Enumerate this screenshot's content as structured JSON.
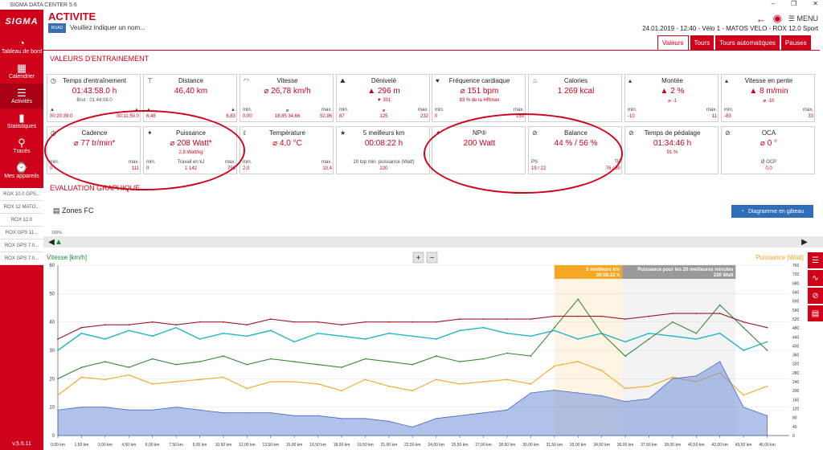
{
  "window": {
    "title": "SIGMA DATA CENTER 5.6",
    "minimize": "–",
    "maximize": "❐",
    "close": "✕"
  },
  "sidebar": {
    "logo": "SIGMA",
    "items": [
      {
        "label": "Tableau de bord",
        "icon": "dashboard-icon",
        "glyph": "◔"
      },
      {
        "label": "Calendrier",
        "icon": "calendar-icon",
        "glyph": "▦"
      },
      {
        "label": "Activités",
        "icon": "activities-icon",
        "glyph": "☰"
      },
      {
        "label": "Statistiques",
        "icon": "stats-icon",
        "glyph": "▮"
      },
      {
        "label": "Tracés",
        "icon": "map-pin-icon",
        "glyph": "⚲"
      },
      {
        "label": "Mes appareils",
        "icon": "devices-icon",
        "glyph": "⌚"
      }
    ],
    "devices": [
      "ROX 10.0 GPS...",
      "ROX 12 MATO...",
      "ROX 12.0",
      "ROX GPS 11...",
      "ROX GPS 7.0...",
      "ROX GPS 7.0..."
    ],
    "version": "v.5.6.11"
  },
  "header": {
    "title": "ACTIVITE",
    "badge": "ROAD",
    "name_placeholder": "Veuillez indiquer un nom...",
    "info": "24.01.2019  -  12:40  -  Vélo 1  -  MATOS VELO  -  ROX 12.0 Sport",
    "menu": "MENU"
  },
  "tabs": [
    "Valeurs",
    "Tours",
    "Tours automatiques",
    "Pauses"
  ],
  "sections": {
    "training": "VALEURS D'ENTRAINEMENT",
    "graph": "EVALUATION GRAPHIQUE"
  },
  "cards": [
    {
      "icon": "clock-icon",
      "glyph": "◷",
      "label": "Temps d'entraînement",
      "main": "01:43:58.0 h",
      "sub": "Brut : 01:44:08.0",
      "row_l": [
        "▲",
        "▲"
      ],
      "row_v": [
        "00:20:39.0",
        "00:11:50.0"
      ]
    },
    {
      "icon": "distance-icon",
      "glyph": "⊤",
      "label": "Distance",
      "main": "46,40 km",
      "row_l": [
        "▲",
        "▲"
      ],
      "row_v": [
        "6,48",
        "6,83"
      ]
    },
    {
      "icon": "speed-icon",
      "glyph": "◠",
      "label": "Vitesse",
      "main": "⌀ 26,78 km/h",
      "row_l": [
        "min.",
        "⌀",
        "max."
      ],
      "row_v": [
        "0,00",
        "18,85  34,66",
        "52,96"
      ]
    },
    {
      "icon": "elevation-icon",
      "glyph": "⛰",
      "label": "Dénivelé",
      "main": "▲ 296 m",
      "sub": "▼ 301",
      "row_l": [
        "min.",
        "⌀",
        "max."
      ],
      "row_v": [
        "87",
        "125",
        "232"
      ]
    },
    {
      "icon": "heart-icon",
      "glyph": "♥",
      "label": "Fréquence cardiaque",
      "main": "⌀ 151 bpm",
      "sub": "83 % de la HRmax",
      "row_l": [
        "min.",
        "max."
      ],
      "row_v": [
        "0",
        "169"
      ]
    },
    {
      "icon": "calories-icon",
      "glyph": "♨",
      "label": "Calories",
      "main": "1 269 kcal"
    },
    {
      "icon": "climb-icon",
      "glyph": "▴",
      "label": "Montée",
      "main": "▲ 2 %",
      "sub": "⌀ -1",
      "row_l": [
        "min.",
        "max."
      ],
      "row_v": [
        "-10",
        "11"
      ]
    },
    {
      "icon": "slope-speed-icon",
      "glyph": "▴",
      "label": "Vitesse en pente",
      "main": "▲ 8 m/min",
      "sub": "⌀ -10",
      "row_l": [
        "min.",
        "max."
      ],
      "row_v": [
        "-83",
        "33"
      ]
    },
    {
      "icon": "cadence-icon",
      "glyph": "◷",
      "label": "Cadence",
      "main": "⌀ 77 tr/min*",
      "row_l": [
        "min.",
        "max."
      ],
      "row_v": [
        "0",
        "111"
      ]
    },
    {
      "icon": "power-icon",
      "glyph": "✦",
      "label": "Puissance",
      "main": "⌀ 208 Watt*",
      "sub": "2,8 Watt/kg",
      "row_l": [
        "min.",
        "Travail en kJ",
        "max."
      ],
      "row_v": [
        "0",
        "1 142",
        "756"
      ]
    },
    {
      "icon": "temperature-icon",
      "glyph": "ℓ",
      "label": "Température",
      "main": "⌀ 4,0 °C",
      "row_l": [
        "min.",
        "max."
      ],
      "row_v": [
        "2,0",
        "10,4"
      ]
    },
    {
      "icon": "star-icon",
      "glyph": "★",
      "label": "5 meilleurs km",
      "main": "00:08:22 h",
      "row_l": [
        "20 top min. puissance (Watt)"
      ],
      "row_v": [
        "220"
      ]
    },
    {
      "icon": "np-icon",
      "glyph": "✦",
      "label": "NP®",
      "main": "200 Watt"
    },
    {
      "icon": "balance-icon",
      "glyph": "⊘",
      "label": "Balance",
      "main": "44 %  /  56 %",
      "row_l": [
        "PS",
        "TE"
      ],
      "row_v": [
        "19  /  22",
        "76  /  80"
      ]
    },
    {
      "icon": "pedal-time-icon",
      "glyph": "⊘",
      "label": "Temps de pédalage",
      "main": "01:34:46 h",
      "sub": "91 %"
    },
    {
      "icon": "oca-icon",
      "glyph": "⊘",
      "label": "OCA",
      "main": "⌀ 0 °",
      "row_l": [
        "Ø OCP"
      ],
      "row_v": [
        "0,0"
      ]
    }
  ],
  "zones": {
    "label": "Zones FC",
    "icon": "bar-chart-icon",
    "button": "Diagramme en gâteau",
    "hundred": "100%"
  },
  "chart_data": {
    "type": "line",
    "title": "",
    "left_axis_label": "Vitesse [km/h]",
    "right_axis_label": "Puissance [Watt]",
    "ylim_left": [
      0,
      60
    ],
    "ylim_right": [
      0,
      760
    ],
    "xlabel": "",
    "left_ticks": [
      "0",
      "10",
      "20",
      "30",
      "40",
      "50",
      "60"
    ],
    "right_ticks": [
      "0",
      "40",
      "80",
      "120",
      "160",
      "200",
      "240",
      "280",
      "320",
      "360",
      "400",
      "440",
      "480",
      "520",
      "560",
      "600",
      "640",
      "680",
      "720",
      "760"
    ],
    "x_ticks": [
      "0,00 km",
      "1,50 km",
      "3,00 km",
      "4,50 km",
      "6,00 km",
      "7,50 km",
      "9,00 km",
      "10,50 km",
      "12,00 km",
      "13,50 km",
      "15,00 km",
      "16,50 km",
      "18,00 km",
      "19,50 km",
      "21,00 km",
      "22,50 km",
      "24,00 km",
      "25,50 km",
      "27,00 km",
      "28,50 km",
      "30,00 km",
      "31,50 km",
      "33,00 km",
      "34,50 km",
      "36,00 km",
      "37,50 km",
      "39,00 km",
      "40,50 km",
      "42,00 km",
      "43,50 km",
      "45,00 km"
    ],
    "series": [
      {
        "name": "Vitesse [km/h]",
        "color": "#1fb5c8",
        "x_km": [
          0,
          1.5,
          3,
          4.5,
          6,
          7.5,
          9,
          10.5,
          12,
          13.5,
          15,
          16.5,
          18,
          19.5,
          21,
          22.5,
          24,
          25.5,
          27,
          28.5,
          30,
          31.5,
          33,
          34.5,
          36,
          37.5,
          39,
          40.5,
          42,
          43.5,
          45
        ],
        "values": [
          30,
          36,
          34,
          37,
          35,
          38,
          34,
          36,
          35,
          37,
          33,
          36,
          35,
          34,
          36,
          35,
          34,
          37,
          38,
          36,
          35,
          37,
          34,
          36,
          33,
          36,
          35,
          34,
          36,
          30,
          33
        ]
      },
      {
        "name": "Puissance [Watt]",
        "color": "#f5a623",
        "x_km": [
          0,
          1.5,
          3,
          4.5,
          6,
          7.5,
          9,
          10.5,
          12,
          13.5,
          15,
          16.5,
          18,
          19.5,
          21,
          22.5,
          24,
          25.5,
          27,
          28.5,
          30,
          31.5,
          33,
          34.5,
          36,
          37.5,
          39,
          40.5,
          42,
          43.5,
          45
        ],
        "values": [
          180,
          260,
          250,
          270,
          230,
          240,
          250,
          260,
          210,
          240,
          240,
          230,
          200,
          250,
          220,
          200,
          250,
          230,
          240,
          250,
          230,
          310,
          330,
          290,
          210,
          220,
          260,
          240,
          280,
          180,
          220
        ]
      },
      {
        "color": "#3a8a3a",
        "x_km": [
          0,
          1.5,
          3,
          4.5,
          6,
          7.5,
          9,
          10.5,
          12,
          13.5,
          15,
          16.5,
          18,
          19.5,
          21,
          22.5,
          24,
          25.5,
          27,
          28.5,
          30,
          31.5,
          33,
          34.5,
          36,
          37.5,
          39,
          40.5,
          42,
          43.5,
          45
        ],
        "values": [
          20,
          24,
          26,
          24,
          27,
          25,
          26,
          28,
          25,
          27,
          26,
          25,
          24,
          27,
          26,
          25,
          28,
          26,
          27,
          29,
          28,
          38,
          48,
          36,
          28,
          34,
          40,
          36,
          46,
          38,
          30
        ]
      },
      {
        "color": "#9b1c2e",
        "x_km": [
          0,
          1.5,
          3,
          4.5,
          6,
          7.5,
          9,
          10.5,
          12,
          13.5,
          15,
          16.5,
          18,
          19.5,
          21,
          22.5,
          24,
          25.5,
          27,
          28.5,
          30,
          31.5,
          33,
          34.5,
          36,
          37.5,
          39,
          40.5,
          42,
          43.5,
          45
        ],
        "values": [
          34,
          38,
          39,
          39,
          40,
          39,
          40,
          40,
          39,
          41,
          40,
          40,
          39,
          40,
          40,
          40,
          40,
          41,
          41,
          41,
          41,
          42,
          42,
          42,
          41,
          42,
          43,
          43,
          43,
          40,
          38
        ]
      },
      {
        "color": "#6f8fd8",
        "x_km": [
          0,
          1.5,
          3,
          4.5,
          6,
          7.5,
          9,
          10.5,
          12,
          13.5,
          15,
          16.5,
          18,
          19.5,
          21,
          22.5,
          24,
          25.5,
          27,
          28.5,
          30,
          31.5,
          33,
          34.5,
          36,
          37.5,
          39,
          40.5,
          42,
          43.5,
          45
        ],
        "values": [
          9,
          10,
          10,
          9,
          9,
          10,
          9,
          8,
          8,
          8,
          7,
          7,
          6,
          6,
          5,
          3,
          6,
          7,
          8,
          9,
          15,
          16,
          15,
          14,
          12,
          13,
          20,
          21,
          26,
          10,
          7
        ]
      }
    ],
    "highlights": [
      {
        "label": "5 meilleurs km",
        "sub": "00:08:22 h",
        "x_km": [
          31.5,
          35.8
        ],
        "color": "#f5a623"
      },
      {
        "label": "Puissance pour les 20 meilleures minutes",
        "sub": "220 Watt",
        "x_km": [
          35.8,
          43.0
        ],
        "color": "#9a9a9a"
      }
    ],
    "grid": true
  }
}
